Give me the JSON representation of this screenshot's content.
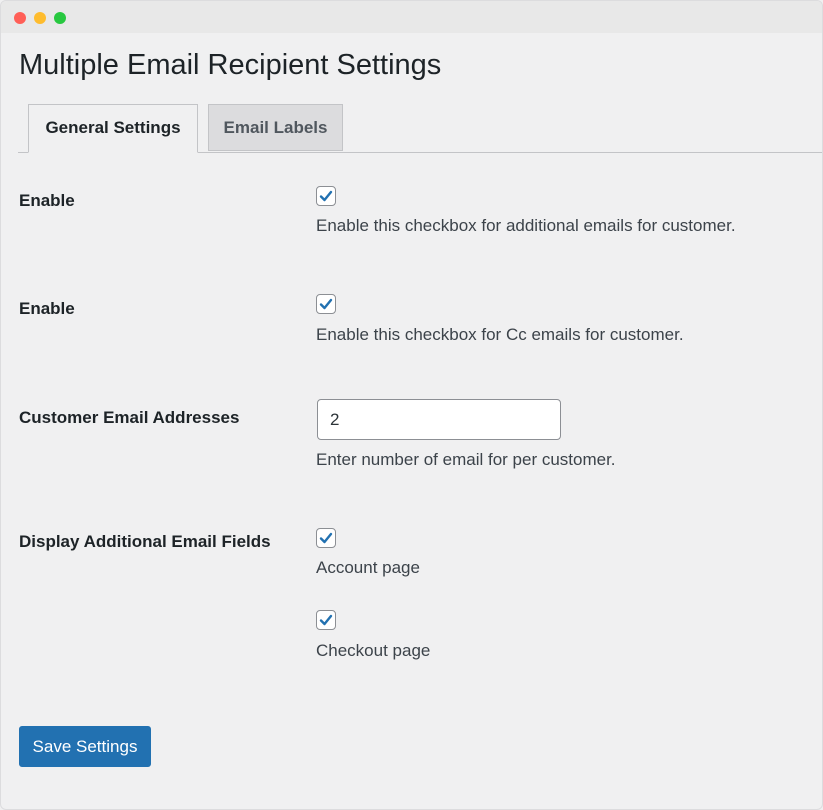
{
  "window": {
    "traffic_lights": [
      {
        "name": "close",
        "color": "#ff5f57"
      },
      {
        "name": "minimize",
        "color": "#febc2e"
      },
      {
        "name": "zoom",
        "color": "#28c840"
      }
    ]
  },
  "page": {
    "title": "Multiple Email Recipient Settings"
  },
  "tabs": [
    {
      "label": "General Settings",
      "active": true
    },
    {
      "label": "Email Labels",
      "active": false
    }
  ],
  "settings": {
    "additional_emails": {
      "label": "Enable",
      "checked": true,
      "description": "Enable this checkbox for additional emails for customer."
    },
    "cc_emails": {
      "label": "Enable",
      "checked": true,
      "description": "Enable this checkbox for Cc emails for customer."
    },
    "customer_email_addresses": {
      "label": "Customer Email Addresses",
      "value": "2",
      "description": "Enter number of email for per customer."
    },
    "display_fields": {
      "label": "Display Additional Email Fields",
      "options": [
        {
          "label": "Account page",
          "checked": true
        },
        {
          "label": "Checkout page",
          "checked": true
        }
      ]
    }
  },
  "actions": {
    "save_label": "Save Settings"
  },
  "colors": {
    "accent": "#2271b1",
    "checkmark": "#2271b1",
    "background": "#f0f0f1"
  }
}
